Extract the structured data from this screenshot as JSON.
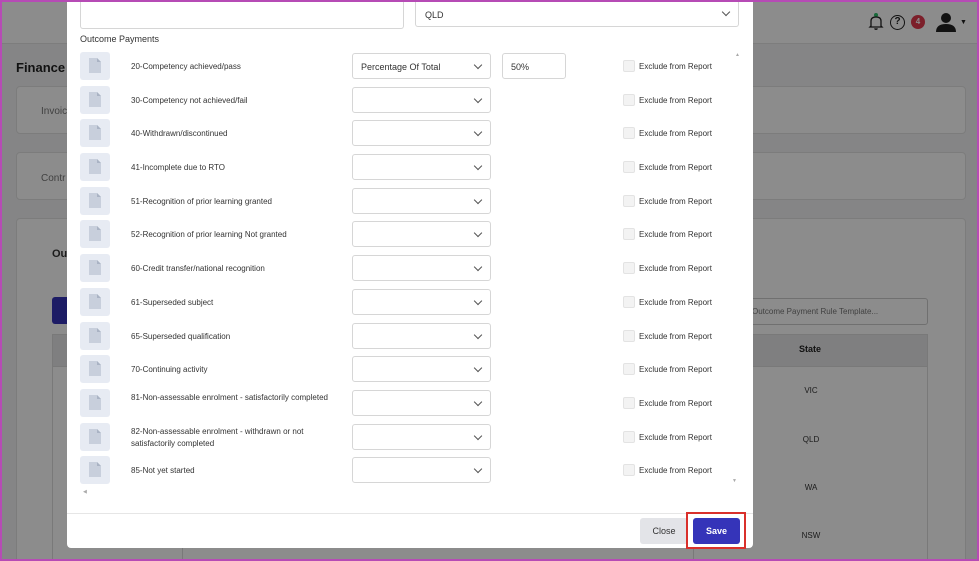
{
  "app": {
    "page_title": "Finance",
    "cards": [
      {
        "label": "Invoic"
      },
      {
        "label": "Contr"
      }
    ],
    "section_label": "Out",
    "search_placeholder": "Outcome Payment Rule Template...",
    "table": {
      "state_header": "State",
      "states": [
        "VIC",
        "QLD",
        "WA",
        "NSW"
      ]
    },
    "notifications_badge": "4",
    "help_icon_glyph": "?"
  },
  "modal": {
    "state_select_value": "QLD",
    "section_title": "Outcome Payments",
    "rows": [
      {
        "label": "20-Competency achieved/pass",
        "select_value": "Percentage Of Total",
        "percent": "50%",
        "exclude_label": "Exclude from Report"
      },
      {
        "label": "30-Competency not achieved/fail",
        "select_value": "",
        "exclude_label": "Exclude from Report"
      },
      {
        "label": "40-Withdrawn/discontinued",
        "select_value": "",
        "exclude_label": "Exclude from Report"
      },
      {
        "label": "41-Incomplete due to RTO",
        "select_value": "",
        "exclude_label": "Exclude from Report"
      },
      {
        "label": "51-Recognition of prior learning granted",
        "select_value": "",
        "exclude_label": "Exclude from Report"
      },
      {
        "label": "52-Recognition of prior learning Not granted",
        "select_value": "",
        "exclude_label": "Exclude from Report"
      },
      {
        "label": "60-Credit transfer/national recognition",
        "select_value": "",
        "exclude_label": "Exclude from Report"
      },
      {
        "label": "61-Superseded subject",
        "select_value": "",
        "exclude_label": "Exclude from Report"
      },
      {
        "label": "65-Superseded qualification",
        "select_value": "",
        "exclude_label": "Exclude from Report"
      },
      {
        "label": "70-Continuing activity",
        "select_value": "",
        "exclude_label": "Exclude from Report"
      },
      {
        "label": "81-Non-assessable enrolment - satisfactorily completed",
        "select_value": "",
        "exclude_label": "Exclude from Report"
      },
      {
        "label": "82-Non-assessable enrolment - withdrawn or not satisfactorily completed",
        "select_value": "",
        "exclude_label": "Exclude from Report"
      },
      {
        "label": "85-Not yet started",
        "select_value": "",
        "exclude_label": "Exclude from Report"
      }
    ],
    "close_label": "Close",
    "save_label": "Save"
  },
  "colors": {
    "primary": "#3534b9",
    "badge": "#e23a4e",
    "highlight": "#d9302b",
    "frame": "#b64bb5"
  }
}
